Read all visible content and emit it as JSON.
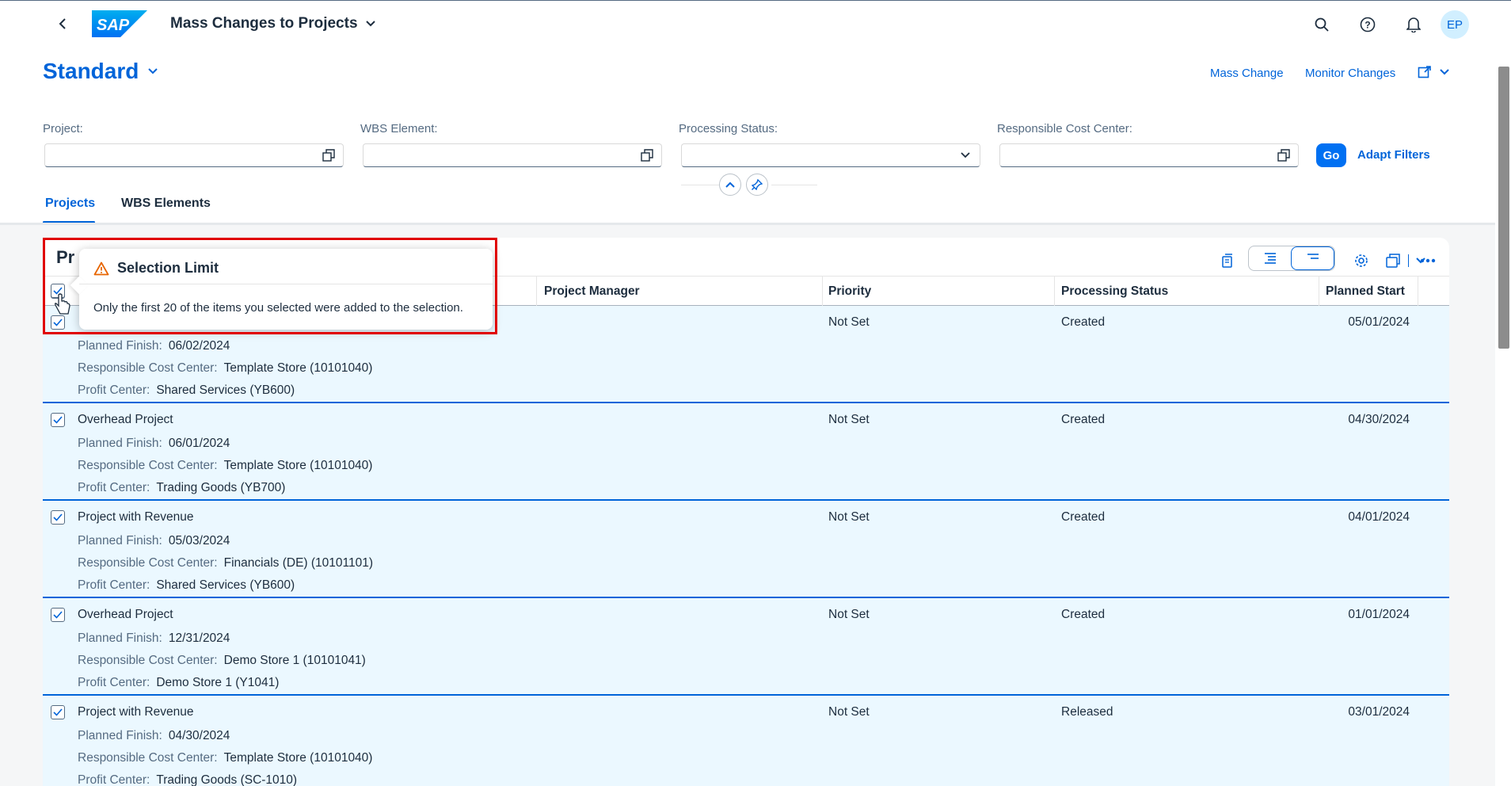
{
  "shell": {
    "app_title": "Mass Changes to Projects",
    "logo_text": "SAP",
    "avatar": "EP",
    "icons": [
      "back-icon",
      "search-icon",
      "help-icon",
      "notification-icon"
    ]
  },
  "header": {
    "variant": "Standard",
    "actions": {
      "mass_change": "Mass Change",
      "monitor_changes": "Monitor Changes"
    }
  },
  "filters": {
    "project_label": "Project:",
    "wbs_label": "WBS Element:",
    "processing_status_label": "Processing Status:",
    "cost_center_label": "Responsible Cost Center:",
    "go": "Go",
    "adapt_filters": "Adapt Filters"
  },
  "tabs": [
    {
      "label": "Projects",
      "active": true
    },
    {
      "label": "WBS Elements",
      "active": false
    }
  ],
  "table": {
    "title": "Pr",
    "columns": {
      "project_manager": "Project Manager",
      "priority": "Priority",
      "processing_status": "Processing Status",
      "planned_start": "Planned Start"
    },
    "detail_labels": {
      "planned_finish": "Planned Finish:",
      "cost_center": "Responsible Cost Center:",
      "profit_center": "Profit Center:"
    },
    "rows": [
      {
        "name": "",
        "planned_finish": "06/02/2024",
        "cost_center": "Template Store (10101040)",
        "profit_center": "Shared Services (YB600)",
        "priority": "Not Set",
        "status": "Created",
        "planned_start": "05/01/2024"
      },
      {
        "name": "Overhead Project",
        "planned_finish": "06/01/2024",
        "cost_center": "Template Store (10101040)",
        "profit_center": "Trading Goods (YB700)",
        "priority": "Not Set",
        "status": "Created",
        "planned_start": "04/30/2024"
      },
      {
        "name": "Project with Revenue",
        "planned_finish": "05/03/2024",
        "cost_center": "Financials (DE) (10101101)",
        "profit_center": "Shared Services (YB600)",
        "priority": "Not Set",
        "status": "Created",
        "planned_start": "04/01/2024"
      },
      {
        "name": "Overhead Project",
        "planned_finish": "12/31/2024",
        "cost_center": "Demo Store 1 (10101041)",
        "profit_center": "Demo Store 1 (Y1041)",
        "priority": "Not Set",
        "status": "Created",
        "planned_start": "01/01/2024"
      },
      {
        "name": "Project with Revenue",
        "planned_finish": "04/30/2024",
        "cost_center": "Template Store (10101040)",
        "profit_center": "Trading Goods (SC-1010)",
        "priority": "Not Set",
        "status": "Released",
        "planned_start": "03/01/2024"
      }
    ]
  },
  "popover": {
    "title": "Selection Limit",
    "message": "Only the first 20 of the items you selected were added to the selection.",
    "icon": "warning-icon"
  },
  "colors": {
    "accent": "#0064d9",
    "row_selected": "#ebf8ff",
    "warning": "#e76500",
    "highlight": "#e00000"
  }
}
